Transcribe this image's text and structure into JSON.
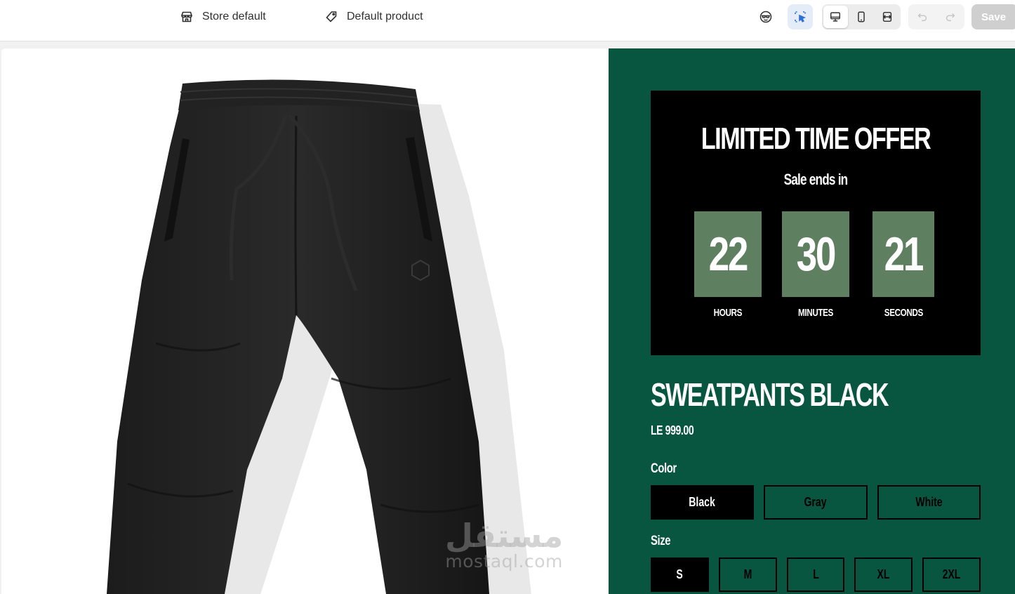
{
  "toolbar": {
    "store_label": "Store default",
    "product_label": "Default product",
    "save_label": "Save",
    "icons": [
      "store-icon",
      "tag-icon",
      "avatar-icon",
      "inspector-icon",
      "desktop-icon",
      "mobile-icon",
      "full-width-icon",
      "undo-icon",
      "redo-icon"
    ]
  },
  "watermark": {
    "arabic": "مستقل",
    "latin": "mostaql.com"
  },
  "offer": {
    "title": "LIMITED TIME OFFER",
    "subtitle": "Sale ends in",
    "timer": [
      {
        "value": "22",
        "label": "HOURS"
      },
      {
        "value": "30",
        "label": "MINUTES"
      },
      {
        "value": "21",
        "label": "SECONDS"
      }
    ]
  },
  "product": {
    "title": "SWEATPANTS BLACK",
    "price": "LE 999.00",
    "color_label": "Color",
    "colors": [
      "Black",
      "Gray",
      "White"
    ],
    "selected_color": "Black",
    "size_label": "Size",
    "sizes": [
      "S",
      "M",
      "L",
      "XL",
      "2XL"
    ],
    "selected_size": "S"
  },
  "colors": {
    "panel_bg": "#085640",
    "timer_box": "#5f7f61",
    "offer_bg": "#000000"
  }
}
